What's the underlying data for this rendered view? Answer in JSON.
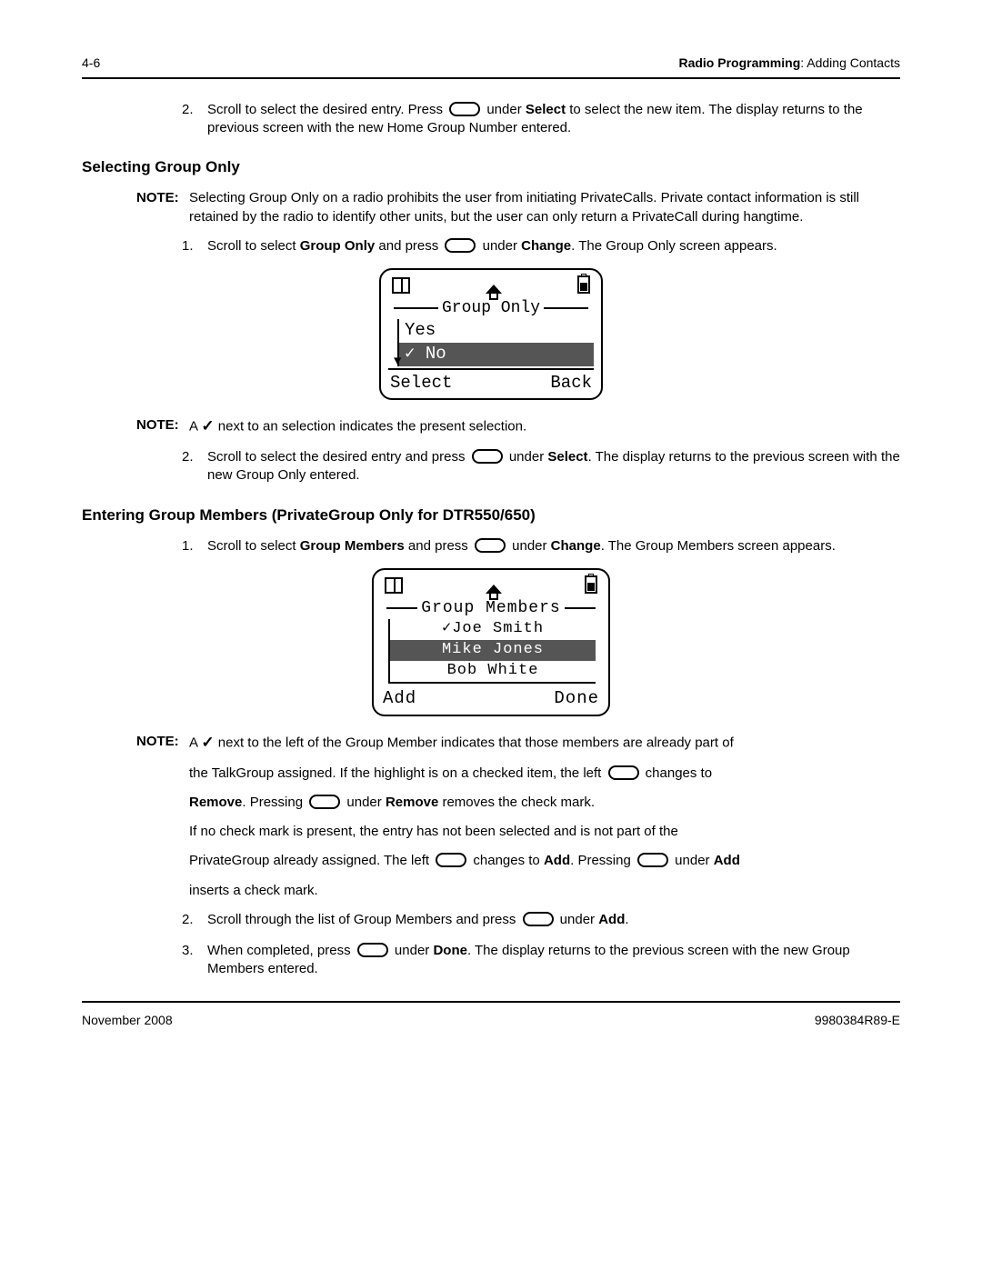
{
  "header": {
    "page_num": "4-6",
    "section_bold": "Radio Programming",
    "section_rest": ": Adding Contacts"
  },
  "intro_step2": {
    "num": "2.",
    "t1": "Scroll to select the desired entry. Press ",
    "t2": " under ",
    "b1": "Select",
    "t3": " to select the new item. The display returns to the previous screen with the new Home Group Number entered."
  },
  "sec1": {
    "heading": "Selecting Group Only",
    "note_label": "NOTE:",
    "note_text": "Selecting Group Only on a radio prohibits the user from initiating PrivateCalls. Private contact information is still retained by the radio to identify other units, but the user can only return a PrivateCall during hangtime.",
    "step1": {
      "num": "1.",
      "t1": "Scroll to select ",
      "b1": "Group Only",
      "t2": " and press ",
      "t3": " under ",
      "b2": "Change",
      "t4": ". The Group Only screen appears."
    },
    "screen": {
      "title": "Group Only",
      "opt_yes": "Yes",
      "opt_no": "No",
      "sk_left": "Select",
      "sk_right": "Back"
    },
    "note2_label": "NOTE:",
    "note2_t1": "A ",
    "note2_t2": " next to an selection indicates the present selection.",
    "step2": {
      "num": "2.",
      "t1": "Scroll to select the desired entry and press ",
      "t2": " under ",
      "b1": "Select",
      "t3": ". The display returns to the previous screen with the new Group Only entered."
    }
  },
  "sec2": {
    "heading": "Entering Group Members (PrivateGroup Only for DTR550/650)",
    "step1": {
      "num": "1.",
      "t1": "Scroll to select ",
      "b1": "Group Members",
      "t2": " and press ",
      "t3": " under ",
      "b2": "Change",
      "t4": ". The Group Members screen appears."
    },
    "screen": {
      "title": "Group Members",
      "m1": "Joe Smith",
      "m2": "Mike Jones",
      "m3": "Bob White",
      "sk_left": "Add",
      "sk_right": "Done"
    },
    "note_label": "NOTE:",
    "note_l1a": "A ",
    "note_l1b": " next to the left of the Group Member indicates that those members are already part of",
    "note_l2a": "the TalkGroup assigned. If the highlight is on a checked item, the left ",
    "note_l2b": " changes to",
    "note_l3a": "Remove",
    "note_l3b": ". Pressing ",
    "note_l3c": " under ",
    "note_l3d": "Remove",
    "note_l3e": " removes the check mark.",
    "note_l4": "If no check mark is present, the entry has not been selected and is not part of the",
    "note_l5a": "PrivateGroup already assigned. The left ",
    "note_l5b": " changes to ",
    "note_l5c": "Add",
    "note_l5d": ". Pressing ",
    "note_l5e": " under ",
    "note_l5f": "Add",
    "note_l6": "inserts a check mark.",
    "step2": {
      "num": "2.",
      "t1": "Scroll through the list of Group Members and press ",
      "t2": " under ",
      "b1": "Add",
      "t3": "."
    },
    "step3": {
      "num": "3.",
      "t1": "When completed, press ",
      "t2": " under ",
      "b1": "Done",
      "t3": ". The display returns to the previous screen with the new Group Members entered."
    }
  },
  "footer": {
    "left": "November 2008",
    "right": "9980384R89-E"
  }
}
